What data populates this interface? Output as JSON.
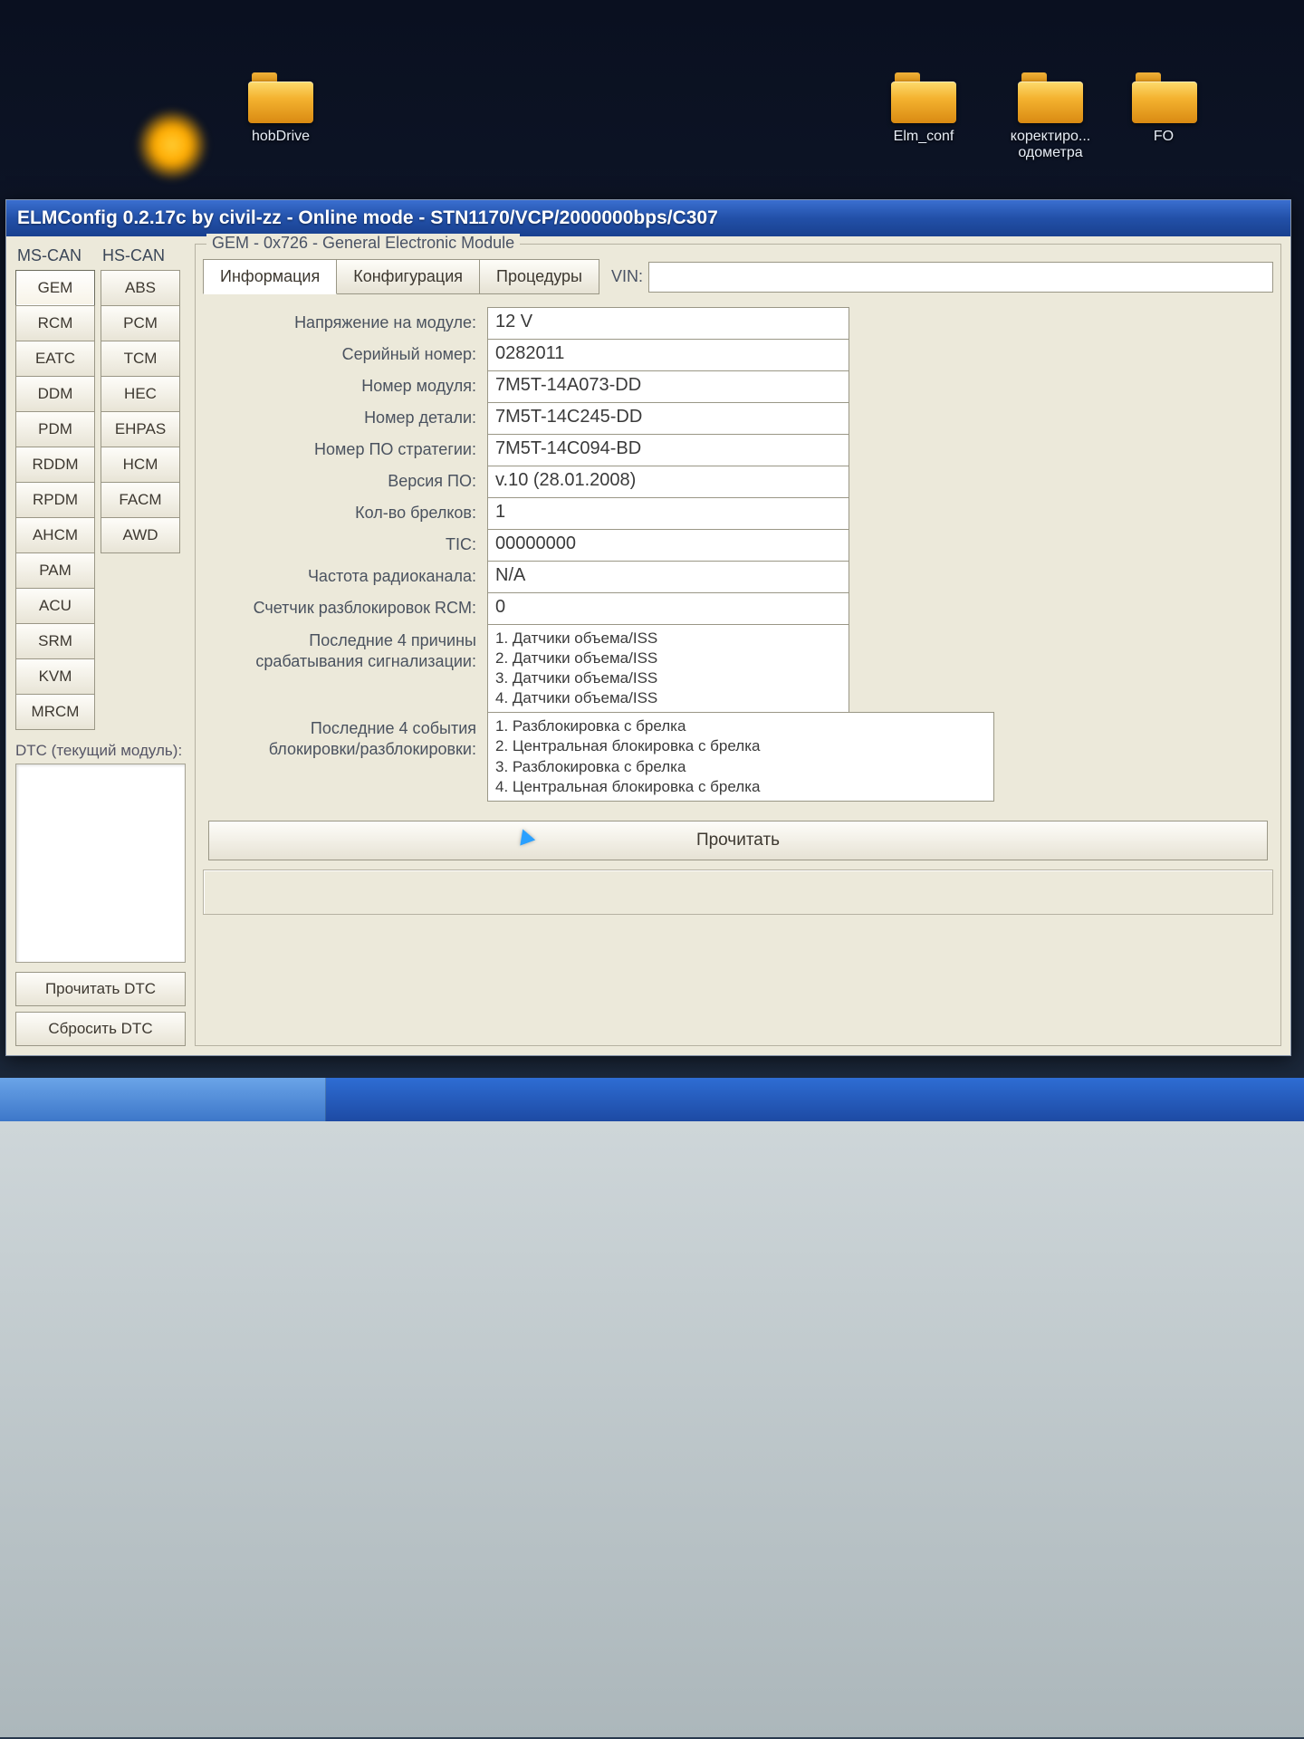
{
  "desktop": {
    "icons": [
      {
        "label": "hobDrive"
      },
      {
        "label": "Elm_conf"
      },
      {
        "label": "коректиро... одометра"
      },
      {
        "label": "FO"
      }
    ]
  },
  "window": {
    "title": "ELMConfig 0.2.17c by civil-zz - Online mode - STN1170/VCP/2000000bps/C307"
  },
  "modules": {
    "mscan_header": "MS-CAN",
    "hscan_header": "HS-CAN",
    "mscan": [
      "GEM",
      "RCM",
      "EATC",
      "DDM",
      "PDM",
      "RDDM",
      "RPDM",
      "AHCM",
      "PAM",
      "ACU",
      "SRM",
      "KVM",
      "MRCM"
    ],
    "hscan": [
      "ABS",
      "PCM",
      "TCM",
      "HEC",
      "EHPAS",
      "HCM",
      "FACM",
      "AWD"
    ],
    "active": "GEM"
  },
  "dtc": {
    "label": "DTC (текущий модуль):",
    "read_btn": "Прочитать DTC",
    "clear_btn": "Сбросить DTC"
  },
  "main": {
    "legend": "GEM - 0x726 - General Electronic Module",
    "tabs": {
      "info": "Информация",
      "config": "Конфигурация",
      "proc": "Процедуры"
    },
    "vin_label": "VIN:",
    "vin_value": "",
    "fields": {
      "voltage_lbl": "Напряжение на модуле:",
      "voltage_val": "12 V",
      "serial_lbl": "Серийный номер:",
      "serial_val": "0282011",
      "module_no_lbl": "Номер модуля:",
      "module_no_val": "7M5T-14A073-DD",
      "part_no_lbl": "Номер детали:",
      "part_no_val": "7M5T-14C245-DD",
      "strategy_lbl": "Номер ПО стратегии:",
      "strategy_val": "7M5T-14C094-BD",
      "fw_ver_lbl": "Версия ПО:",
      "fw_ver_val": "v.10 (28.01.2008)",
      "fobs_lbl": "Кол-во брелков:",
      "fobs_val": "1",
      "tic_lbl": "TIC:",
      "tic_val": "00000000",
      "radio_lbl": "Частота радиоканала:",
      "radio_val": "N/A",
      "rcm_unlock_lbl": "Счетчик разблокировок RCM:",
      "rcm_unlock_val": "0",
      "alarm_lbl": "Последние 4 причины\nсрабатывания сигнализации:",
      "alarm_val": "1. Датчики объема/ISS\n2. Датчики объема/ISS\n3. Датчики объема/ISS\n4. Датчики объема/ISS",
      "lock_lbl": "Последние 4 события\nблокировки/разблокировки:",
      "lock_val": "1. Разблокировка с брелка\n2. Центральная блокировка с брелка\n3. Разблокировка с брелка\n4. Центральная блокировка с брелка"
    },
    "read_button": "Прочитать"
  }
}
